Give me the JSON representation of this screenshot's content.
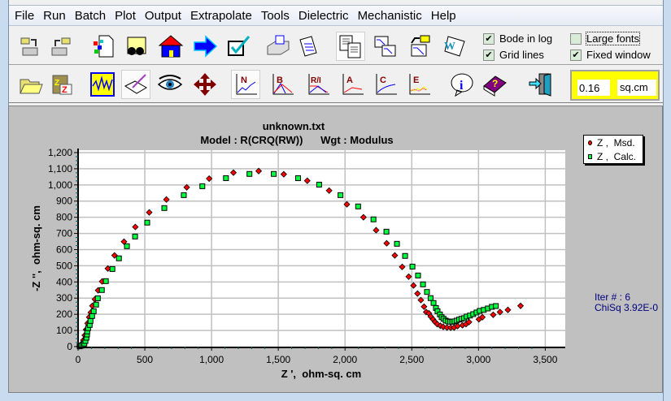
{
  "menu": [
    "File",
    "Run",
    "Batch",
    "Plot",
    "Output",
    "Extrapolate",
    "Tools",
    "Dielectric",
    "Mechanistic",
    "Help"
  ],
  "toolbar1": {
    "icons": [
      "load-data-icon",
      "save-data-icon",
      "model-builder-icon",
      "find-files-icon",
      "home-icon",
      "run-arrow-icon",
      "check-icon",
      "printer-icon",
      "documents-icon",
      "copy-text-icon",
      "copy-graphs-icon",
      "export-graph-icon",
      "word-export-icon"
    ],
    "checkboxes": [
      {
        "label": "Bode in log",
        "checked": true
      },
      {
        "label": "Grid lines",
        "checked": true
      },
      {
        "label": "Large fonts",
        "checked": false
      },
      {
        "label": "Fixed window",
        "checked": true
      }
    ]
  },
  "toolbar2": {
    "icons": [
      "open-folder-icon",
      "sleep-clipboard-icon",
      "waveform-icon",
      "notepad-edit-icon",
      "eye-view-icon",
      "move-arrows-icon",
      "nyquist-plot-icon",
      "bode-plot-icon",
      "resistance-plot-icon",
      "admittance-plot-icon",
      "capacitance-plot-icon",
      "error-plot-icon",
      "info-icon",
      "help-book-icon",
      "exit-door-icon"
    ],
    "icon_labels": [
      "N",
      "B",
      "R/I",
      "A",
      "C",
      "E"
    ],
    "area_value": "0.16",
    "area_unit": "sq.cm",
    "area_bg": "#ffff00"
  },
  "legend": [
    {
      "label": "Z ,  Msd.",
      "color": "#ff0000"
    },
    {
      "label": "Z ,  Calc.",
      "color": "#00ff40"
    }
  ],
  "fit": {
    "iter": "Iter # :  6",
    "chisq": "ChiSq 3.92E-0"
  },
  "chart_data": {
    "type": "scatter",
    "title": "unknown.txt",
    "subtitle": "Model : R(CRQ(RW))      Wgt : Modulus",
    "xlabel": "Z ',  ohm-sq. cm",
    "ylabel": "-Z '',  ohm-sq. cm",
    "xlim": [
      0,
      3650
    ],
    "ylim": [
      0,
      1215
    ],
    "xticks": [
      "0",
      "500",
      "1,000",
      "1,500",
      "2,000",
      "2,500",
      "3,000",
      "3,500"
    ],
    "xtick_values": [
      0,
      500,
      1000,
      1500,
      2000,
      2500,
      3000,
      3500
    ],
    "yticks": [
      "0",
      "100",
      "200",
      "300",
      "400",
      "500",
      "600",
      "700",
      "800",
      "900",
      "1,000",
      "1,100",
      "1,200"
    ],
    "ytick_values": [
      0,
      100,
      200,
      300,
      400,
      500,
      600,
      700,
      800,
      900,
      1000,
      1100,
      1200
    ],
    "grid": true,
    "legend_position": "top-right",
    "series": [
      {
        "name": "Z ,  Msd.",
        "marker": "diamond",
        "color": "#ff0000",
        "points": [
          [
            10,
            2
          ],
          [
            20,
            8
          ],
          [
            30,
            20
          ],
          [
            40,
            40
          ],
          [
            50,
            70
          ],
          [
            60,
            105
          ],
          [
            71,
            144
          ],
          [
            83,
            182
          ],
          [
            95,
            211
          ],
          [
            107,
            252
          ],
          [
            126,
            293
          ],
          [
            150,
            348
          ],
          [
            180,
            403
          ],
          [
            223,
            483
          ],
          [
            273,
            564
          ],
          [
            344,
            649
          ],
          [
            429,
            740
          ],
          [
            533,
            830
          ],
          [
            662,
            910
          ],
          [
            814,
            985
          ],
          [
            982,
            1039
          ],
          [
            1164,
            1076
          ],
          [
            1353,
            1086
          ],
          [
            1541,
            1066
          ],
          [
            1717,
            1026
          ],
          [
            1881,
            965
          ],
          [
            2014,
            880
          ],
          [
            2138,
            800
          ],
          [
            2233,
            720
          ],
          [
            2312,
            639
          ],
          [
            2373,
            564
          ],
          [
            2428,
            493
          ],
          [
            2477,
            433
          ],
          [
            2513,
            378
          ],
          [
            2543,
            328
          ],
          [
            2568,
            288
          ],
          [
            2592,
            247
          ],
          [
            2608,
            214
          ],
          [
            2628,
            206
          ],
          [
            2642,
            186
          ],
          [
            2659,
            169
          ],
          [
            2675,
            152
          ],
          [
            2691,
            139
          ],
          [
            2714,
            129
          ],
          [
            2736,
            122
          ],
          [
            2764,
            118
          ],
          [
            2792,
            117
          ],
          [
            2817,
            118
          ],
          [
            2843,
            127
          ],
          [
            2880,
            132
          ],
          [
            2906,
            139
          ],
          [
            2929,
            152
          ],
          [
            3003,
            169
          ],
          [
            3029,
            182
          ],
          [
            3110,
            197
          ],
          [
            3161,
            214
          ],
          [
            3220,
            227
          ],
          [
            3315,
            252
          ]
        ]
      },
      {
        "name": "Z ,  Calc.",
        "marker": "square",
        "color": "#00ff40",
        "points": [
          [
            12,
            2
          ],
          [
            25,
            6
          ],
          [
            38,
            12
          ],
          [
            47,
            19
          ],
          [
            55,
            35
          ],
          [
            63,
            55
          ],
          [
            67,
            75
          ],
          [
            69,
            94
          ],
          [
            75,
            114
          ],
          [
            87,
            134
          ],
          [
            93,
            159
          ],
          [
            105,
            189
          ],
          [
            117,
            219
          ],
          [
            135,
            260
          ],
          [
            148,
            299
          ],
          [
            178,
            350
          ],
          [
            208,
            405
          ],
          [
            257,
            480
          ],
          [
            306,
            546
          ],
          [
            366,
            621
          ],
          [
            427,
            681
          ],
          [
            518,
            767
          ],
          [
            646,
            857
          ],
          [
            792,
            937
          ],
          [
            931,
            992
          ],
          [
            1108,
            1042
          ],
          [
            1284,
            1068
          ],
          [
            1466,
            1068
          ],
          [
            1648,
            1042
          ],
          [
            1806,
            1002
          ],
          [
            1966,
            937
          ],
          [
            2098,
            867
          ],
          [
            2213,
            787
          ],
          [
            2310,
            711
          ],
          [
            2389,
            636
          ],
          [
            2450,
            561
          ],
          [
            2505,
            495
          ],
          [
            2547,
            440
          ],
          [
            2584,
            385
          ],
          [
            2614,
            338
          ],
          [
            2641,
            300
          ],
          [
            2663,
            270
          ],
          [
            2681,
            239
          ],
          [
            2693,
            219
          ],
          [
            2711,
            199
          ],
          [
            2724,
            182
          ],
          [
            2738,
            172
          ],
          [
            2754,
            161
          ],
          [
            2772,
            156
          ],
          [
            2788,
            154
          ],
          [
            2804,
            154
          ],
          [
            2820,
            156
          ],
          [
            2837,
            161
          ],
          [
            2855,
            167
          ],
          [
            2873,
            172
          ],
          [
            2891,
            176
          ],
          [
            2911,
            186
          ],
          [
            2936,
            192
          ],
          [
            2960,
            201
          ],
          [
            2985,
            211
          ],
          [
            3009,
            221
          ],
          [
            3039,
            227
          ],
          [
            3070,
            236
          ],
          [
            3100,
            246
          ],
          [
            3130,
            251
          ]
        ]
      }
    ]
  }
}
